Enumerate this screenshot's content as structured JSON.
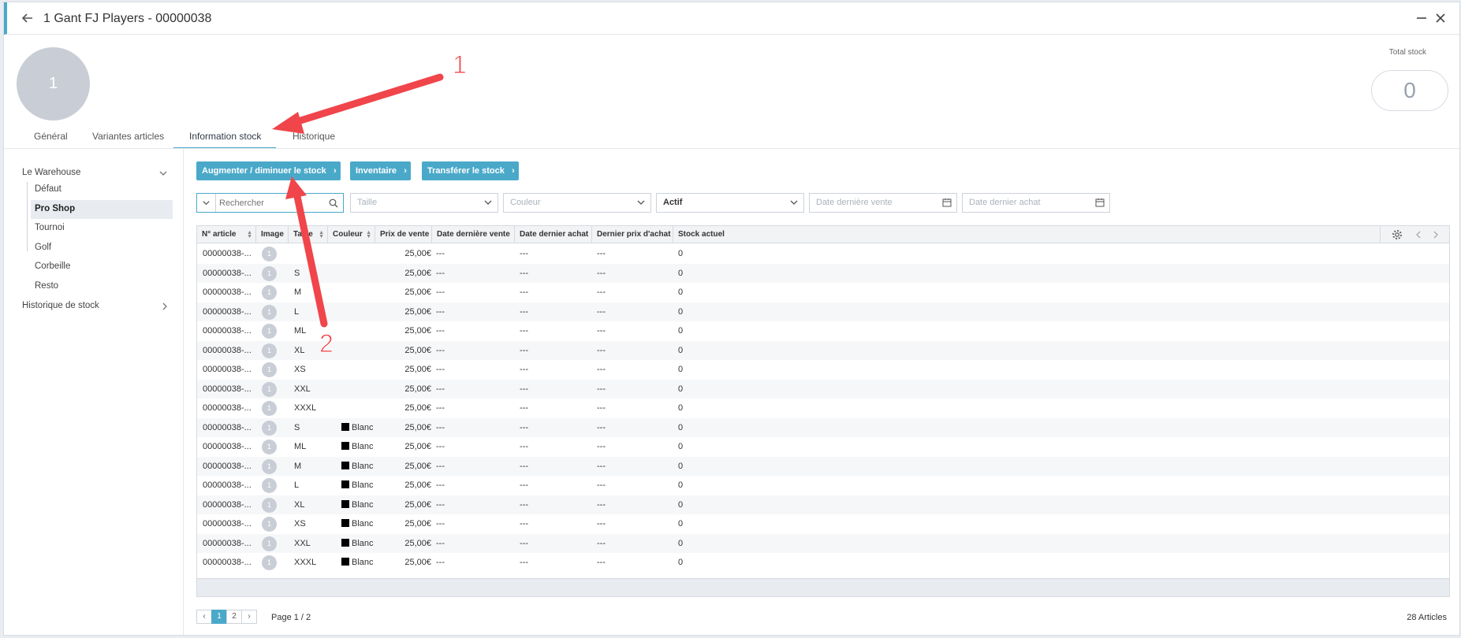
{
  "header": {
    "title": "1 Gant FJ Players - 00000038",
    "avatar_text": "1",
    "total_stock_label": "Total stock",
    "total_stock_value": "0"
  },
  "tabs": [
    {
      "label": "Général",
      "active": false
    },
    {
      "label": "Variantes articles",
      "active": false
    },
    {
      "label": "Information stock",
      "active": true
    },
    {
      "label": "Historique",
      "active": false
    }
  ],
  "sidebar": {
    "warehouse": "Le Warehouse",
    "items": [
      "Défaut",
      "Pro Shop",
      "Tournoi",
      "Golf",
      "Corbeille",
      "Resto"
    ],
    "selected": "Pro Shop",
    "history": "Historique de stock"
  },
  "actions": {
    "adjust": "Augmenter / diminuer le stock",
    "inventory": "Inventaire",
    "transfer": "Transférer le stock"
  },
  "filters": {
    "search_placeholder": "Rechercher",
    "size_placeholder": "Taille",
    "color_placeholder": "Couleur",
    "status_value": "Actif",
    "last_sale_placeholder": "Date dernière vente",
    "last_purchase_placeholder": "Date dernier achat"
  },
  "table": {
    "columns": [
      "N° article",
      "Image",
      "Taille",
      "Couleur",
      "Prix de vente",
      "Date dernière vente",
      "Date dernier achat",
      "Dernier prix d'achat",
      "Stock actuel"
    ],
    "rows": [
      {
        "article": "00000038-...",
        "image": "1",
        "size": "",
        "color": "",
        "price": "25,00€",
        "last_sale": "---",
        "last_purchase": "---",
        "last_purchase_price": "---",
        "stock": "0"
      },
      {
        "article": "00000038-...",
        "image": "1",
        "size": "S",
        "color": "",
        "price": "25,00€",
        "last_sale": "---",
        "last_purchase": "---",
        "last_purchase_price": "---",
        "stock": "0"
      },
      {
        "article": "00000038-...",
        "image": "1",
        "size": "M",
        "color": "",
        "price": "25,00€",
        "last_sale": "---",
        "last_purchase": "---",
        "last_purchase_price": "---",
        "stock": "0"
      },
      {
        "article": "00000038-...",
        "image": "1",
        "size": "L",
        "color": "",
        "price": "25,00€",
        "last_sale": "---",
        "last_purchase": "---",
        "last_purchase_price": "---",
        "stock": "0"
      },
      {
        "article": "00000038-...",
        "image": "1",
        "size": "ML",
        "color": "",
        "price": "25,00€",
        "last_sale": "---",
        "last_purchase": "---",
        "last_purchase_price": "---",
        "stock": "0"
      },
      {
        "article": "00000038-...",
        "image": "1",
        "size": "XL",
        "color": "",
        "price": "25,00€",
        "last_sale": "---",
        "last_purchase": "---",
        "last_purchase_price": "---",
        "stock": "0"
      },
      {
        "article": "00000038-...",
        "image": "1",
        "size": "XS",
        "color": "",
        "price": "25,00€",
        "last_sale": "---",
        "last_purchase": "---",
        "last_purchase_price": "---",
        "stock": "0"
      },
      {
        "article": "00000038-...",
        "image": "1",
        "size": "XXL",
        "color": "",
        "price": "25,00€",
        "last_sale": "---",
        "last_purchase": "---",
        "last_purchase_price": "---",
        "stock": "0"
      },
      {
        "article": "00000038-...",
        "image": "1",
        "size": "XXXL",
        "color": "",
        "price": "25,00€",
        "last_sale": "---",
        "last_purchase": "---",
        "last_purchase_price": "---",
        "stock": "0"
      },
      {
        "article": "00000038-...",
        "image": "1",
        "size": "S",
        "color": "Blanc",
        "price": "25,00€",
        "last_sale": "---",
        "last_purchase": "---",
        "last_purchase_price": "---",
        "stock": "0"
      },
      {
        "article": "00000038-...",
        "image": "1",
        "size": "ML",
        "color": "Blanc",
        "price": "25,00€",
        "last_sale": "---",
        "last_purchase": "---",
        "last_purchase_price": "---",
        "stock": "0"
      },
      {
        "article": "00000038-...",
        "image": "1",
        "size": "M",
        "color": "Blanc",
        "price": "25,00€",
        "last_sale": "---",
        "last_purchase": "---",
        "last_purchase_price": "---",
        "stock": "0"
      },
      {
        "article": "00000038-...",
        "image": "1",
        "size": "L",
        "color": "Blanc",
        "price": "25,00€",
        "last_sale": "---",
        "last_purchase": "---",
        "last_purchase_price": "---",
        "stock": "0"
      },
      {
        "article": "00000038-...",
        "image": "1",
        "size": "XL",
        "color": "Blanc",
        "price": "25,00€",
        "last_sale": "---",
        "last_purchase": "---",
        "last_purchase_price": "---",
        "stock": "0"
      },
      {
        "article": "00000038-...",
        "image": "1",
        "size": "XS",
        "color": "Blanc",
        "price": "25,00€",
        "last_sale": "---",
        "last_purchase": "---",
        "last_purchase_price": "---",
        "stock": "0"
      },
      {
        "article": "00000038-...",
        "image": "1",
        "size": "XXL",
        "color": "Blanc",
        "price": "25,00€",
        "last_sale": "---",
        "last_purchase": "---",
        "last_purchase_price": "---",
        "stock": "0"
      },
      {
        "article": "00000038-...",
        "image": "1",
        "size": "XXXL",
        "color": "Blanc",
        "price": "25,00€",
        "last_sale": "---",
        "last_purchase": "---",
        "last_purchase_price": "---",
        "stock": "0"
      }
    ]
  },
  "pagination": {
    "pages": [
      "1",
      "2"
    ],
    "current": "1",
    "label": "Page 1 / 2",
    "count": "28 Articles"
  },
  "annotations": {
    "marker_1": "1",
    "marker_2": "2"
  },
  "colors": {
    "accent": "#4aa9c9",
    "arrow": "#f0454a"
  }
}
